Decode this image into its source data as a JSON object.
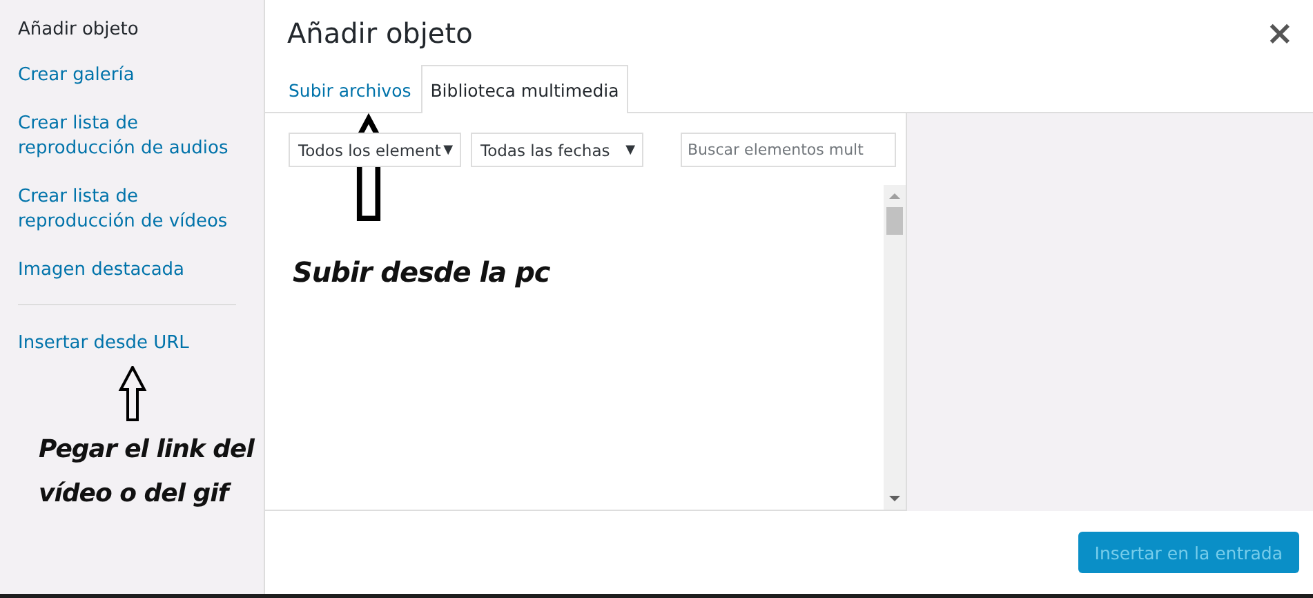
{
  "sidebar": {
    "title": "Añadir objeto",
    "items": [
      {
        "label": "Crear galería"
      },
      {
        "label": "Crear lista de reproducción de audios"
      },
      {
        "label": "Crear lista de reproducción de vídeos"
      },
      {
        "label": "Imagen destacada"
      },
      {
        "label": "Insertar desde URL",
        "separated": true
      }
    ]
  },
  "modal": {
    "title": "Añadir objeto",
    "close": "×",
    "tabs": [
      {
        "label": "Subir archivos",
        "selected": false
      },
      {
        "label": "Biblioteca multimedia",
        "selected": true
      }
    ],
    "filters": [
      {
        "value": "Todos los element",
        "caret": "▼"
      },
      {
        "value": "Todas las fechas",
        "caret": "▼"
      }
    ],
    "search": {
      "placeholder": "Buscar elementos mult"
    },
    "insert_button": {
      "label": "Insertar en la entrada",
      "disabled": true
    }
  },
  "annotations": [
    {
      "text": "Subir desde la pc",
      "kind": "tab"
    },
    {
      "text": "Pegar el link del vídeo o del gif",
      "kind": "sidebar"
    }
  ]
}
